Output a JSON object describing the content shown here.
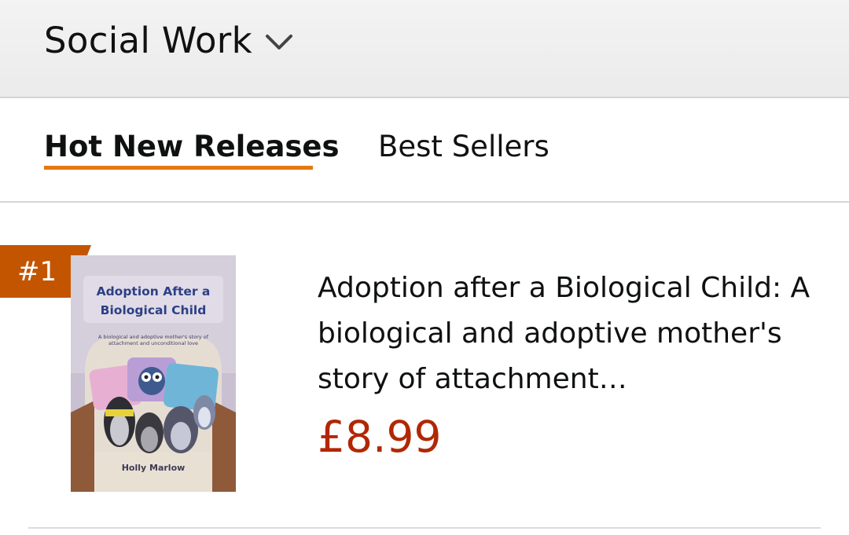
{
  "header": {
    "category_title": "Social Work",
    "dropdown_icon": "chevron-down-icon"
  },
  "tabs": [
    {
      "label": "Hot New Releases",
      "active": true
    },
    {
      "label": "Best Sellers",
      "active": false
    }
  ],
  "colors": {
    "accent": "#e47911",
    "rank_badge": "#c45500",
    "price": "#b12704"
  },
  "items": [
    {
      "rank": "#1",
      "cover": {
        "title": "Adoption After a Biological Child",
        "subtitle": "A biological and adoptive mother's story of attachment and unconditional love",
        "author": "Holly Marlow"
      },
      "title": "Adoption after a Biological Child: A biological and adoptive mother's story of attachment…",
      "price": "£8.99"
    }
  ]
}
